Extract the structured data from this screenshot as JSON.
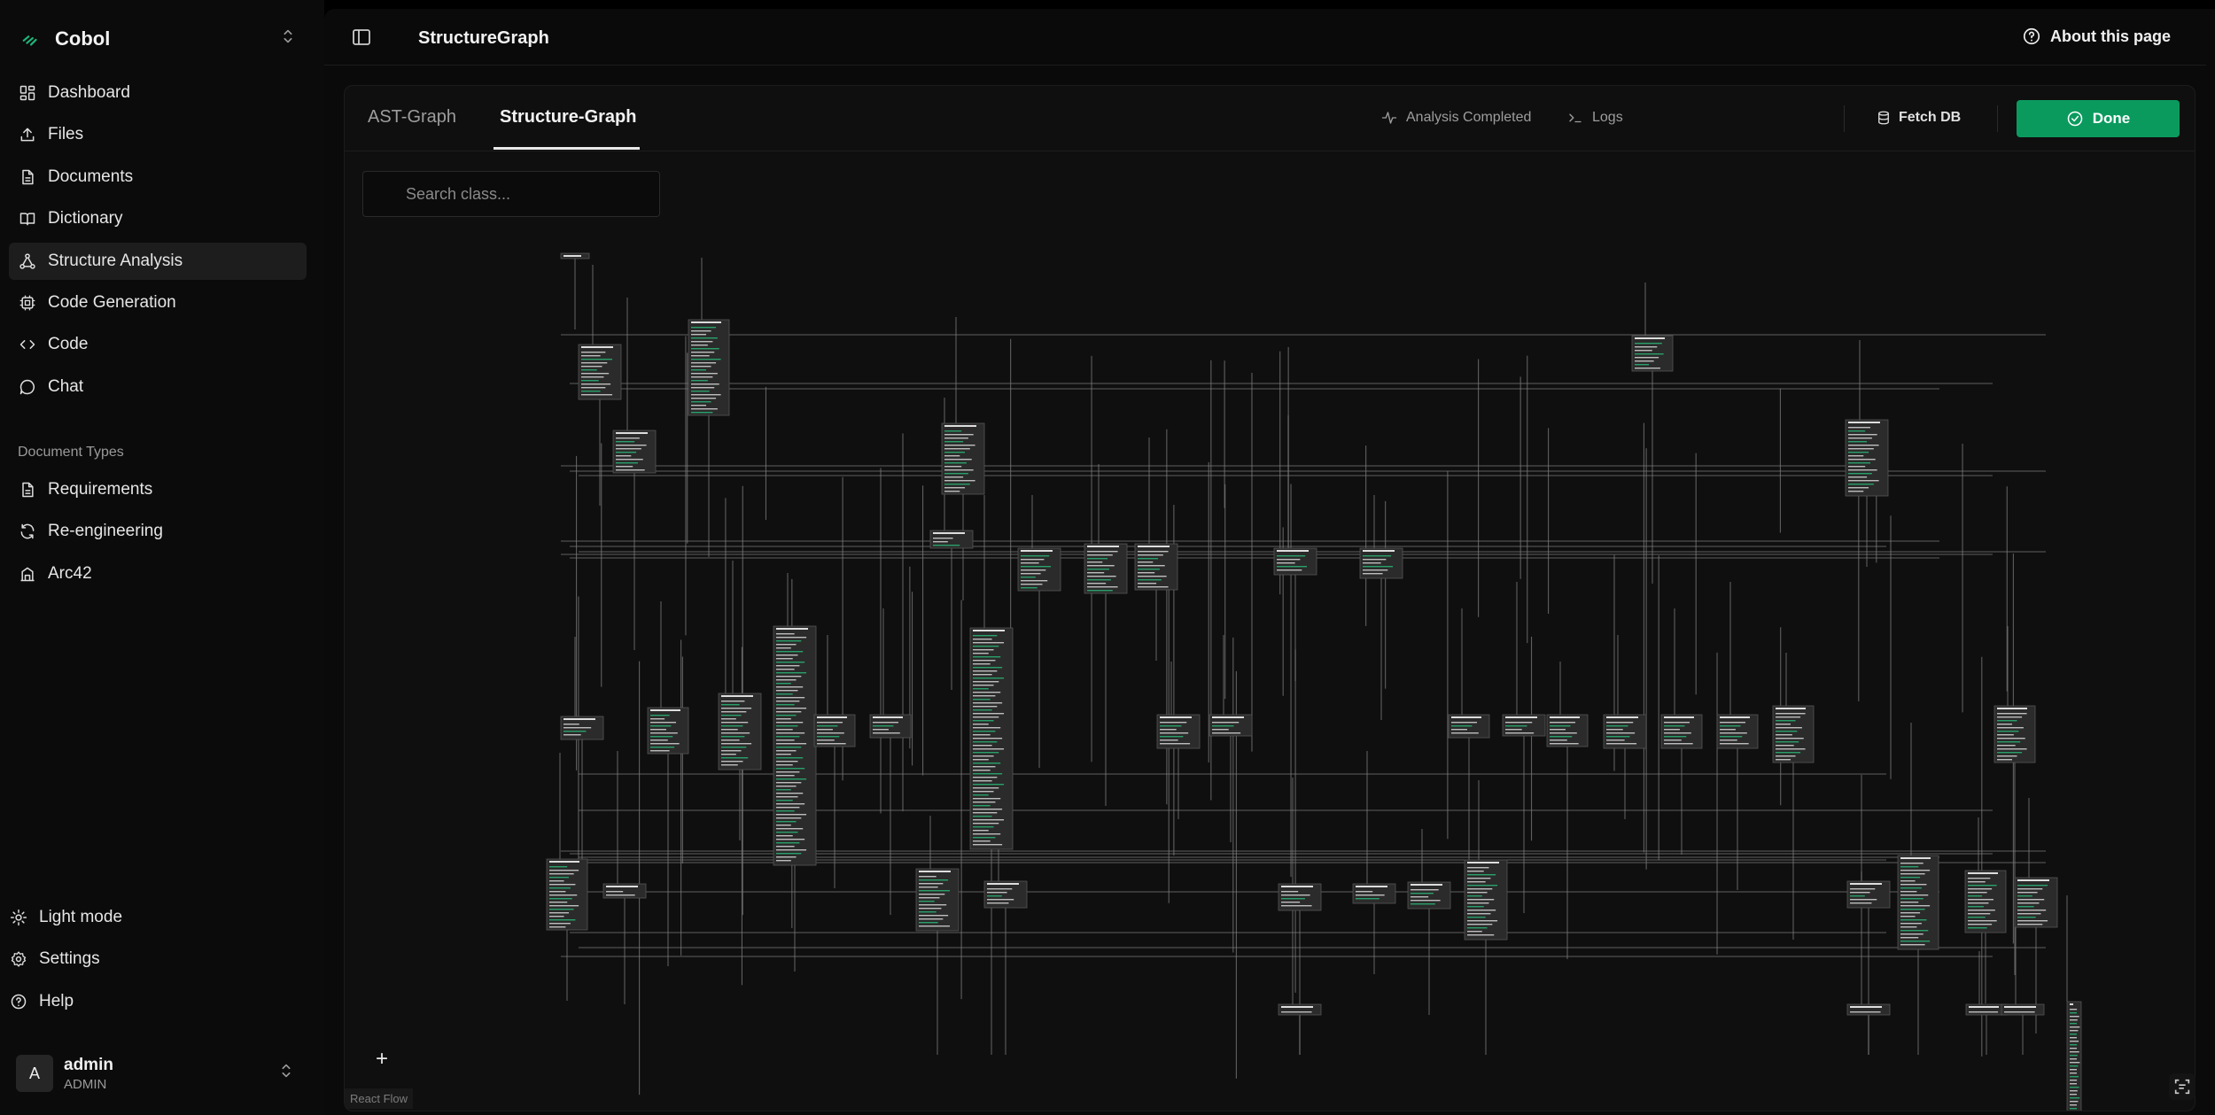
{
  "app": {
    "name": "Cobol"
  },
  "sidebar": {
    "nav": [
      {
        "label": "Dashboard",
        "icon": "dashboard-icon"
      },
      {
        "label": "Files",
        "icon": "upload-icon"
      },
      {
        "label": "Documents",
        "icon": "document-icon"
      },
      {
        "label": "Dictionary",
        "icon": "book-icon"
      },
      {
        "label": "Structure Analysis",
        "icon": "structure-icon",
        "active": true
      },
      {
        "label": "Code Generation",
        "icon": "chip-icon"
      },
      {
        "label": "Code",
        "icon": "code-icon"
      },
      {
        "label": "Chat",
        "icon": "chat-icon"
      }
    ],
    "section_label": "Document Types",
    "doc_types": [
      {
        "label": "Requirements",
        "icon": "document-icon"
      },
      {
        "label": "Re-engineering",
        "icon": "refresh-icon"
      },
      {
        "label": "Arc42",
        "icon": "building-icon"
      }
    ],
    "bottom": {
      "light_mode": "Light mode",
      "settings": "Settings",
      "help": "Help"
    },
    "user": {
      "initial": "A",
      "name": "admin",
      "role": "ADMIN"
    }
  },
  "header": {
    "title": "StructureGraph",
    "about": "About this page"
  },
  "panel": {
    "tabs": [
      {
        "label": "AST-Graph",
        "active": false
      },
      {
        "label": "Structure-Graph",
        "active": true
      }
    ],
    "status": "Analysis Completed",
    "logs": "Logs",
    "fetch": "Fetch DB",
    "done": "Done",
    "search_placeholder": "Search class...",
    "controls": {
      "zoom_in": "+",
      "zoom_out": "–"
    },
    "attribution": "React Flow"
  },
  "colors": {
    "accent": "#0b9a5e",
    "field_green": "#2aa06a",
    "node_bg": "#2b2b2b",
    "edge": "#7a7a7a"
  }
}
